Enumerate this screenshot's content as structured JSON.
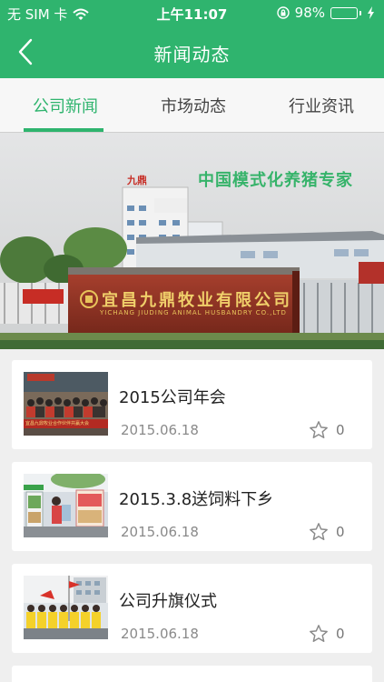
{
  "status_bar": {
    "carrier": "无 SIM 卡",
    "time": "上午11:07",
    "battery": "98%",
    "battery_level": 0.98
  },
  "header": {
    "title": "新闻动态",
    "back_icon": "chevron-left-icon"
  },
  "tabs": [
    {
      "label": "公司新闻",
      "active": true
    },
    {
      "label": "市场动态",
      "active": false
    },
    {
      "label": "行业资讯",
      "active": false
    }
  ],
  "banner": {
    "caption": "中国模式化养猪专家",
    "sign_text": "宜昌九鼎牧业有限公司",
    "sign_subtext": "YICHANG JIUDING ANIMAL HUSBANDRY CO.,LTD",
    "building_sign": "九鼎"
  },
  "news": [
    {
      "title": "2015公司年会",
      "date": "2015.06.18",
      "favorites": "0",
      "thumb_banner": "宜昌九鼎牧业合作伙伴共赢大会"
    },
    {
      "title": "2015.3.8送饲料下乡",
      "date": "2015.06.18",
      "favorites": "0"
    },
    {
      "title": "公司升旗仪式",
      "date": "2015.06.18",
      "favorites": "0"
    }
  ],
  "colors": {
    "accent": "#2fb46e",
    "background": "#efefef"
  }
}
